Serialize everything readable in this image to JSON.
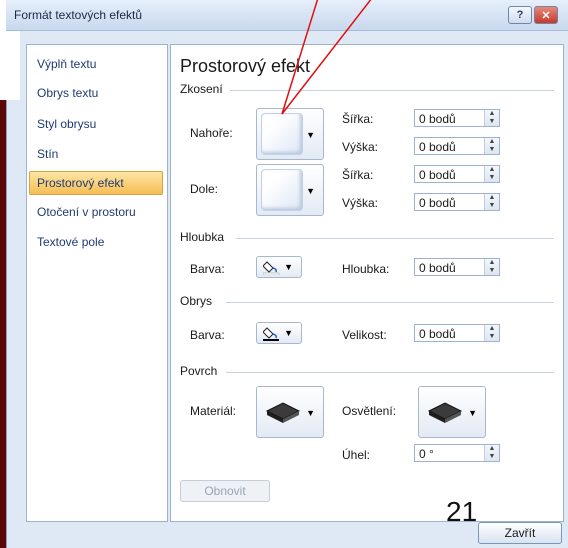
{
  "window": {
    "title": "Formát textových efektů",
    "help_glyph": "?",
    "close_glyph": "✕"
  },
  "nav": {
    "items": [
      "Výplň textu",
      "Obrys textu",
      "Styl obrysu",
      "Stín",
      "Prostorový efekt",
      "Otočení v prostoru",
      "Textové pole"
    ],
    "selected": "Prostorový efekt"
  },
  "panel": {
    "title": "Prostorový efekt",
    "bevel": {
      "section": "Zkosení",
      "top_label": "Nahoře:",
      "bottom_label": "Dole:",
      "width_label": "Šířka:",
      "height_label": "Výška:",
      "top_width": "0 bodů",
      "top_height": "0 bodů",
      "bottom_width": "0 bodů",
      "bottom_height": "0 bodů"
    },
    "depth": {
      "section": "Hloubka",
      "color_label": "Barva:",
      "depth_label": "Hloubka:",
      "depth_value": "0 bodů"
    },
    "contour": {
      "section": "Obrys",
      "color_label": "Barva:",
      "size_label": "Velikost:",
      "size_value": "0 bodů"
    },
    "surface": {
      "section": "Povrch",
      "material_label": "Materiál:",
      "lighting_label": "Osvětlení:",
      "angle_label": "Úhel:",
      "angle_value": "0 °"
    },
    "reset_label": "Obnovit"
  },
  "footer": {
    "close_label": "Zavřít",
    "slide_number": "21"
  },
  "colors": {
    "accent": "#f6be55",
    "slide_bg": "#7a1010",
    "callout_line": "#e01010"
  }
}
